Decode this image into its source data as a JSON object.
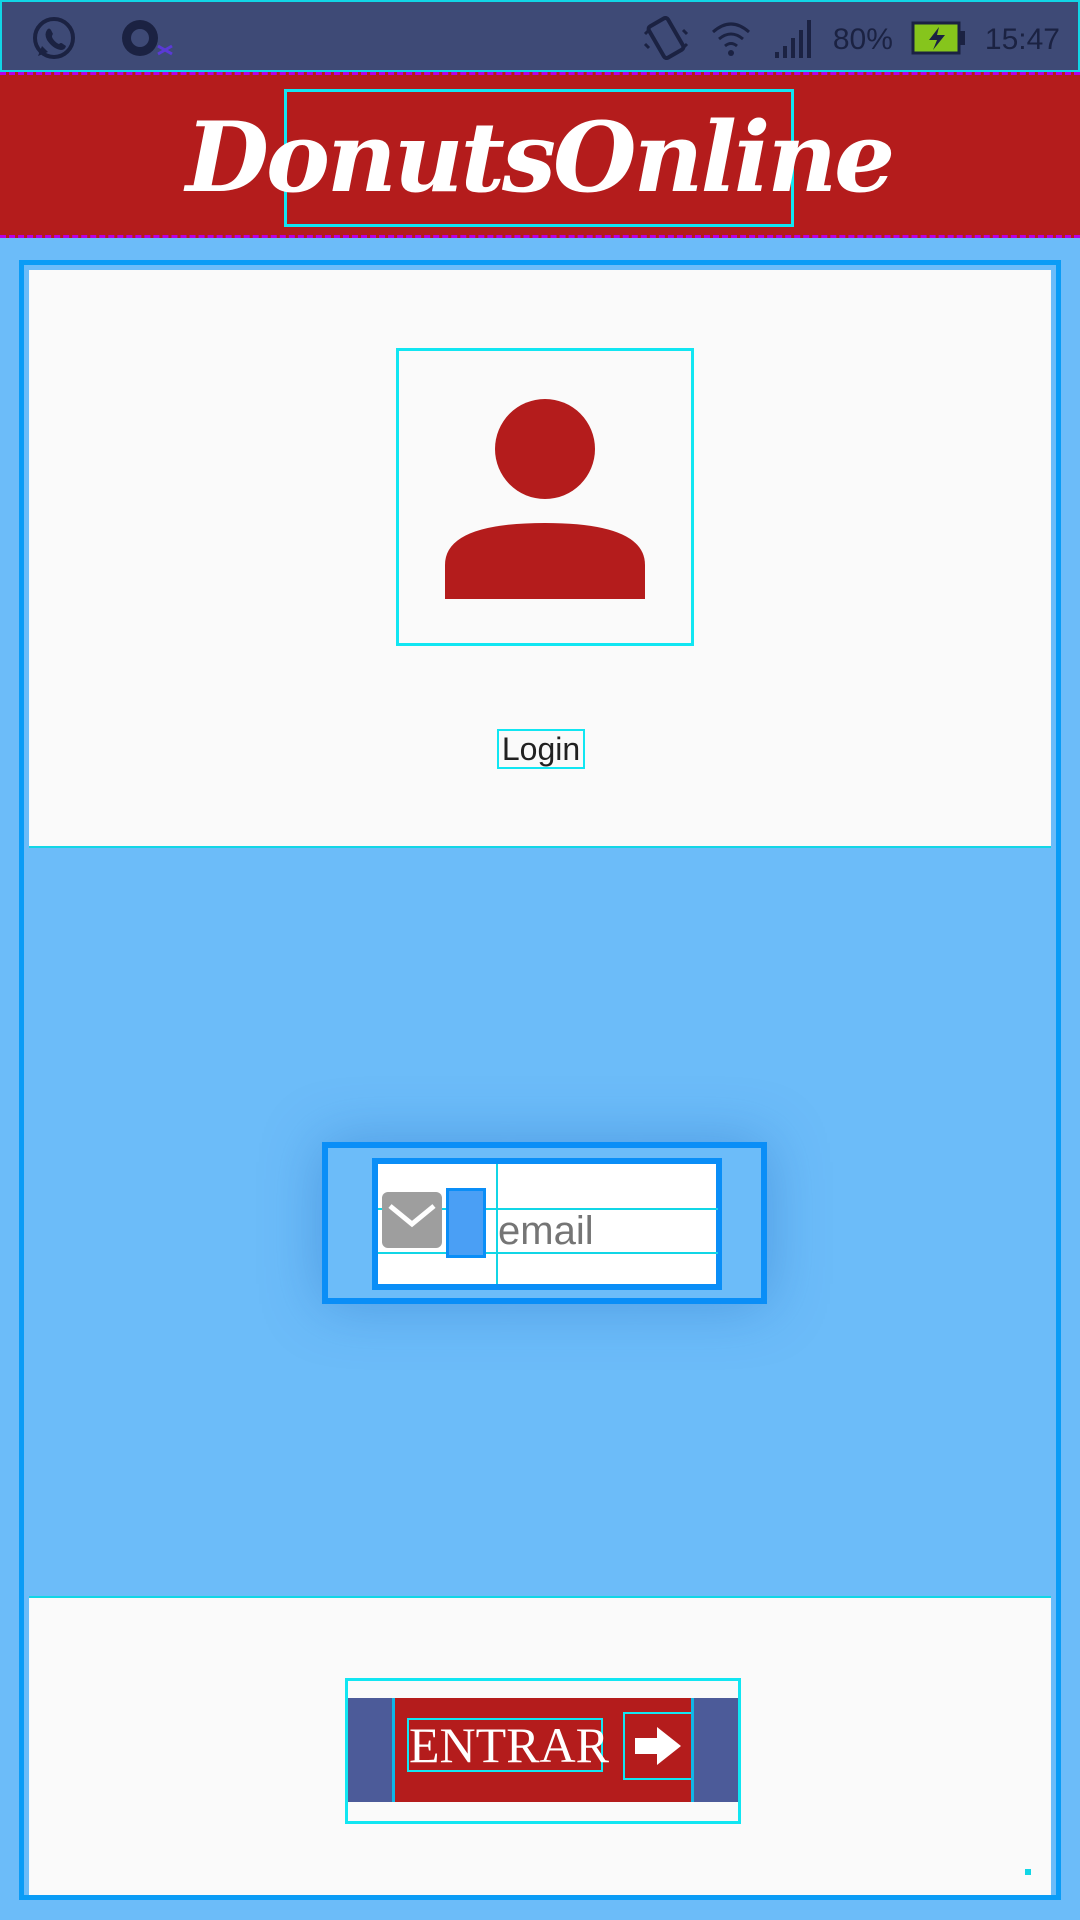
{
  "status_bar": {
    "battery": "80%",
    "time": "15:47",
    "icons": [
      "whatsapp-icon",
      "app-circle-icon",
      "vibrate-icon",
      "wifi-icon",
      "signal-icon",
      "battery-charging-icon"
    ]
  },
  "header": {
    "title": "DonutsOnline",
    "background_color": "#b41c1c"
  },
  "login": {
    "avatar_icon": "person-icon",
    "title": "Login",
    "email_icon": "mail-icon",
    "email_placeholder": "email",
    "email_value": "",
    "submit_label": "ENTRAR",
    "submit_icon": "arrow-right-icon"
  },
  "colors": {
    "accent": "#b41c1c",
    "panel_blue": "#6cbcf9",
    "statusbar": "#3e4a76"
  }
}
